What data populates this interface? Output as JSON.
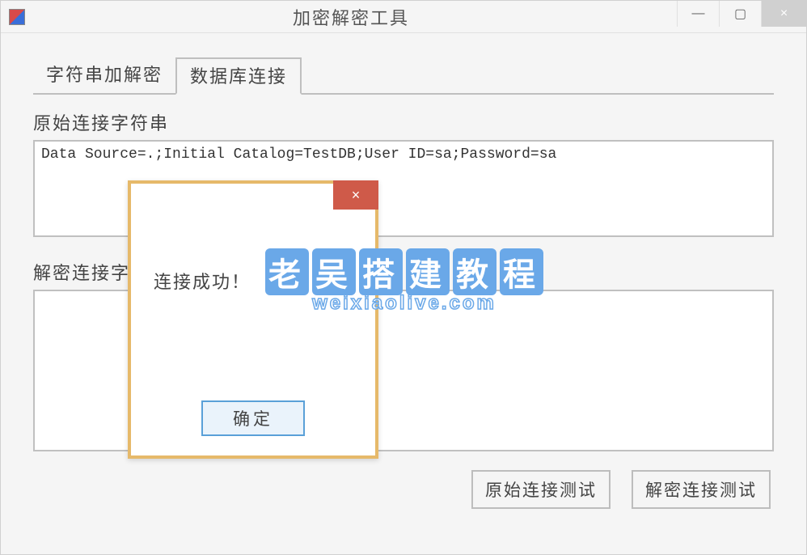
{
  "window": {
    "title": "加密解密工具",
    "controls": {
      "minimize": "—",
      "maximize": "▢",
      "close": "×"
    }
  },
  "tabs": {
    "tab1": "字符串加解密",
    "tab2": "数据库连接"
  },
  "fields": {
    "original_label": "原始连接字符串",
    "original_value": "Data Source=.;Initial Catalog=TestDB;User ID=sa;Password=sa",
    "decrypted_label": "解密连接字符串",
    "decrypted_value": ""
  },
  "buttons": {
    "test_original": "原始连接测试",
    "test_decrypted": "解密连接测试"
  },
  "msgbox": {
    "message": "连接成功！",
    "ok": "确定",
    "close": "×"
  },
  "watermark": {
    "line1_chars": [
      "老",
      "吴",
      "搭",
      "建",
      "教",
      "程"
    ],
    "line2": "weixiaolive.com"
  }
}
